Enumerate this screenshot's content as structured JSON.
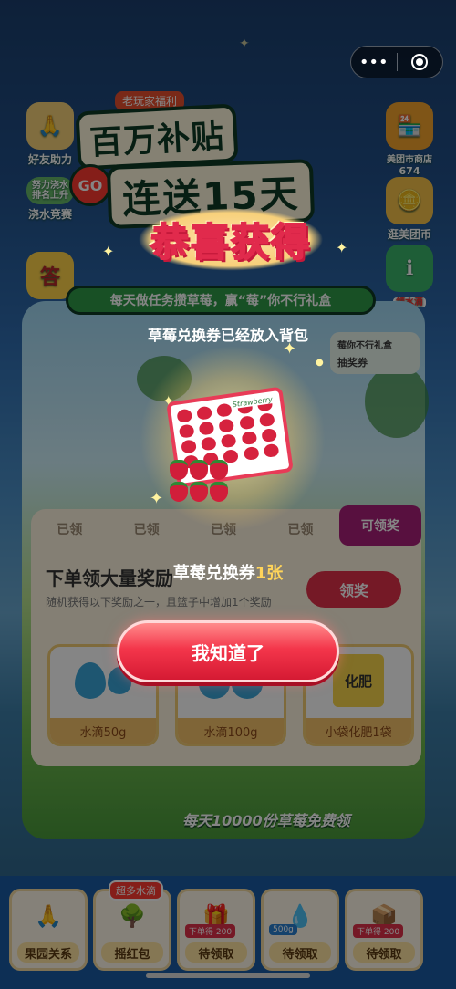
{
  "capsule": {
    "more_icon_label": "•••",
    "target_icon": "target-icon"
  },
  "hero": {
    "tag": "老玩家福利",
    "line1": "百万补贴",
    "go": "GO",
    "line2": "连送15天",
    "subtitle": "每天做任务攒草莓，赢“莓”你不行礼盒"
  },
  "side_left": [
    {
      "label": "好友助力",
      "icon": "hands-icon"
    },
    {
      "label": "浇水竞赛",
      "icon": "watering-icon",
      "sub": "努力浇水 排名上升"
    },
    {
      "label": "答",
      "icon": "quiz-icon"
    }
  ],
  "side_right": [
    {
      "label": "美团市商店",
      "count": "674",
      "icon": "shop-icon"
    },
    {
      "label": "逛美团币",
      "icon": "coin-icon"
    },
    {
      "label": "领水滴",
      "icon": "info-icon"
    }
  ],
  "lottery": {
    "line1": "莓你不行礼盒",
    "line2": "抽奖券"
  },
  "task": {
    "tabs": [
      "已领",
      "已领",
      "已领",
      "已领",
      "可领奖"
    ],
    "title": "下单领大量奖励",
    "desc": "随机获得以下奖励之一，且篮子中增加1个奖励",
    "claim": "领奖",
    "rewards": [
      {
        "label": "水滴50g",
        "type": "drops"
      },
      {
        "label": "水滴100g",
        "type": "drops"
      },
      {
        "label": "小袋化肥1袋",
        "type": "fertilizer",
        "bag_text": "化肥"
      }
    ]
  },
  "bottom_banner": "每天10000份草莓免费领",
  "bottom_bar": [
    {
      "label": "果园关系",
      "icon": "hands-icon"
    },
    {
      "label": "摇红包",
      "icon": "tree-icon",
      "badge": "超多水滴"
    },
    {
      "label": "待领取",
      "icon": "gift-icon",
      "small": "下单得 200"
    },
    {
      "label": "待领取",
      "icon": "drop-icon",
      "small": "500g"
    },
    {
      "label": "待领取",
      "icon": "box-icon",
      "small": "下单得 200"
    }
  ],
  "modal": {
    "congrats": "恭喜获得",
    "message": "草莓兑换券已经放入背包",
    "voucher_name": "草莓兑换券",
    "voucher_count": "1张",
    "box_label": "Strawberry",
    "ok_button": "我知道了"
  },
  "colors": {
    "accent_red": "#e0304a",
    "gold": "#ffd45a",
    "green": "#2f9a47"
  }
}
